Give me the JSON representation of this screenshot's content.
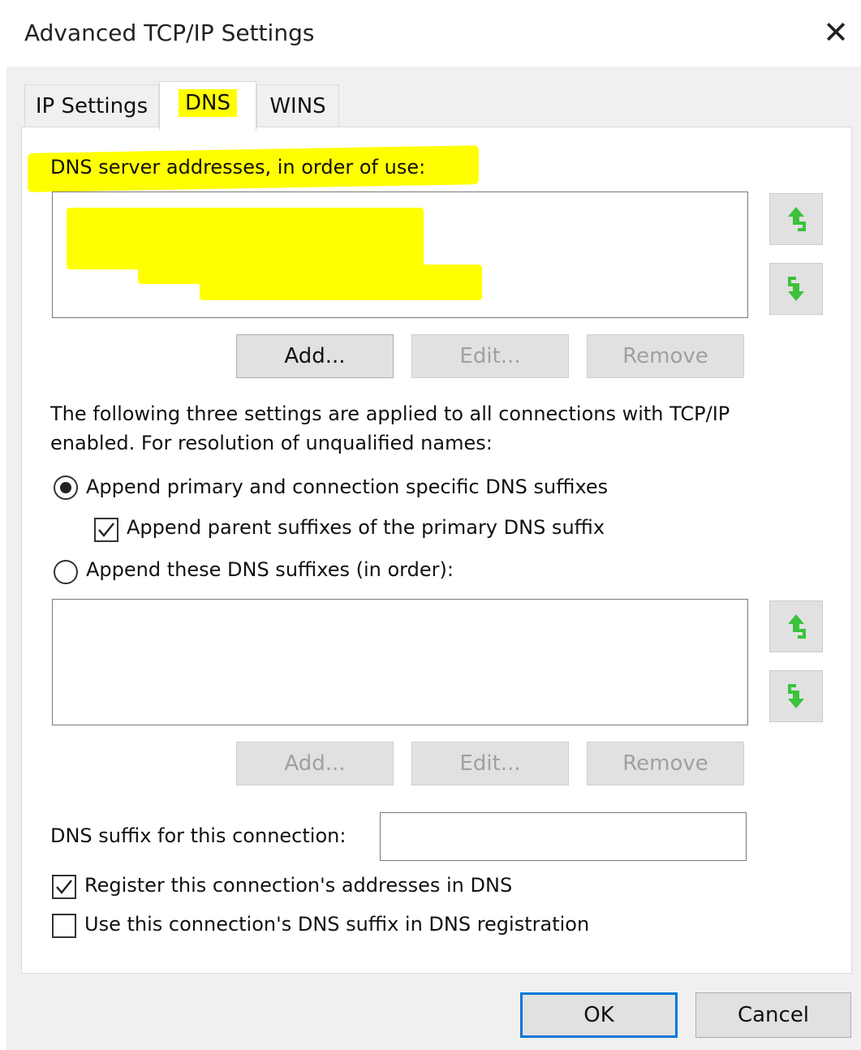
{
  "window": {
    "title": "Advanced TCP/IP Settings",
    "close_glyph": "✕"
  },
  "tabs": [
    {
      "label": "IP Settings",
      "active": false
    },
    {
      "label": "DNS",
      "active": true
    },
    {
      "label": "WINS",
      "active": false
    }
  ],
  "dns": {
    "servers_label": "DNS server addresses, in order of use:",
    "servers": [],
    "buttons": {
      "add": "Add...",
      "edit": "Edit...",
      "remove": "Remove"
    },
    "info_text_line1": "The following three settings are applied to all connections with TCP/IP",
    "info_text_line2": "enabled. For resolution of unqualified names:",
    "radio_primary_label": "Append primary and connection specific DNS suffixes",
    "radio_primary_selected": true,
    "check_parent_label": "Append parent suffixes of the primary DNS suffix",
    "check_parent_checked": true,
    "radio_these_label": "Append these DNS suffixes (in order):",
    "radio_these_selected": false,
    "suffixes": [],
    "suffix_buttons": {
      "add": "Add...",
      "edit": "Edit...",
      "remove": "Remove"
    },
    "connection_suffix_label": "DNS suffix for this connection:",
    "connection_suffix_value": "",
    "register_label": "Register this connection's addresses in DNS",
    "register_checked": true,
    "use_suffix_label": "Use this connection's DNS suffix in DNS registration",
    "use_suffix_checked": false
  },
  "footer": {
    "ok": "OK",
    "cancel": "Cancel"
  },
  "colors": {
    "highlight": "#ffff00",
    "arrow_green": "#3cc23c",
    "default_button_border": "#0078d7"
  },
  "icons": [
    "close-icon",
    "arrow-up-icon",
    "arrow-down-icon",
    "checkmark-icon"
  ]
}
